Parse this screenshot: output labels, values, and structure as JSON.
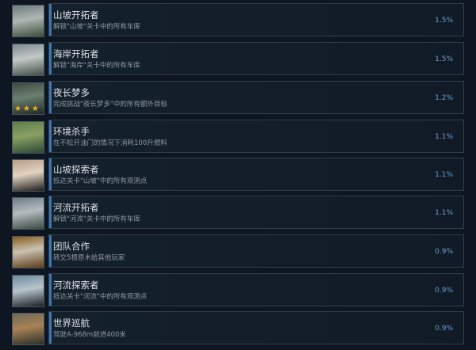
{
  "achievements": [
    {
      "title": "山坡开拓者",
      "description": "解锁\"山坡\"关卡中的所有车库",
      "percent": "1.5%",
      "icon": "garage-hill-icon",
      "colors": [
        "#6b7a7c",
        "#b0b7b5",
        "#3c4c3a"
      ]
    },
    {
      "title": "海岸开拓者",
      "description": "解锁\"海岸\"关卡中的所有车库",
      "percent": "1.5%",
      "icon": "garage-coast-icon",
      "colors": [
        "#7d8a8f",
        "#c3c8c6",
        "#3e4d44"
      ]
    },
    {
      "title": "夜长梦多",
      "description": "完成挑战\"夜长梦多\"中的所有额外目标",
      "percent": "1.2%",
      "icon": "night-challenge-icon",
      "colors": [
        "#3c4a40",
        "#6b7f70",
        "#1f2a24"
      ],
      "stars": "★★★"
    },
    {
      "title": "环境杀手",
      "description": "在不松开油门的情况下消耗100升燃料",
      "percent": "1.1%",
      "icon": "swamp-icon",
      "colors": [
        "#5f7d4a",
        "#8aa064",
        "#2b4733"
      ]
    },
    {
      "title": "山坡探索者",
      "description": "抵达关卡\"山坡\"中的所有观测点",
      "percent": "1.1%",
      "icon": "watchpoint-hill-icon",
      "colors": [
        "#b79e86",
        "#e2d3c2",
        "#1d1c1b"
      ]
    },
    {
      "title": "河流开拓者",
      "description": "解锁\"河流\"关卡中的所有车库",
      "percent": "1.1%",
      "icon": "garage-river-icon",
      "colors": [
        "#6d7b86",
        "#b5bcc0",
        "#3b4a42"
      ]
    },
    {
      "title": "团队合作",
      "description": "转交5根原木给其他玩家",
      "percent": "0.9%",
      "icon": "logs-icon",
      "colors": [
        "#8a5a1c",
        "#c9c2b3",
        "#5b3a14"
      ]
    },
    {
      "title": "河流探索者",
      "description": "抵达关卡\"河流\"中的所有观测点",
      "percent": "0.9%",
      "icon": "watchpoint-river-icon",
      "colors": [
        "#6c8a9e",
        "#b8c4cc",
        "#1b1f23"
      ]
    },
    {
      "title": "世界巡航",
      "description": "驾驶A-968m前进400米",
      "percent": "0.9%",
      "icon": "car-icon",
      "colors": [
        "#6e6a55",
        "#a88157",
        "#2a2f28"
      ]
    }
  ]
}
